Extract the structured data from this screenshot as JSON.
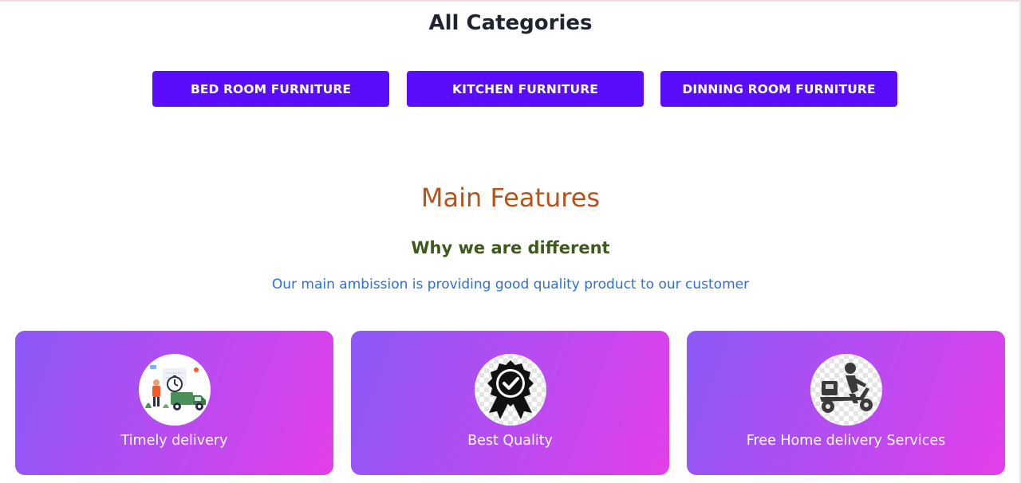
{
  "categories": {
    "title": "All Categories",
    "buttons": [
      {
        "label": "BED ROOM FURNITURE"
      },
      {
        "label": "KITCHEN FURNITURE"
      },
      {
        "label": "DINNING ROOM FURNITURE"
      }
    ]
  },
  "features": {
    "title": "Main Features",
    "subtitle": "Why we are different",
    "description": "Our main ambission is providing good quality product to our customer",
    "cards": [
      {
        "label": "Timely delivery",
        "icon": "delivery-truck-icon"
      },
      {
        "label": "Best Quality",
        "icon": "quality-badge-icon"
      },
      {
        "label": "Free Home delivery Services",
        "icon": "scooter-delivery-icon"
      }
    ]
  },
  "colors": {
    "button_bg": "#5a0dfb",
    "features_title": "#b3541e",
    "features_subtitle": "#3d5a1c",
    "features_description": "#2f6fd6",
    "card_gradient_start": "#8c59f7",
    "card_gradient_end": "#e33ee9"
  }
}
